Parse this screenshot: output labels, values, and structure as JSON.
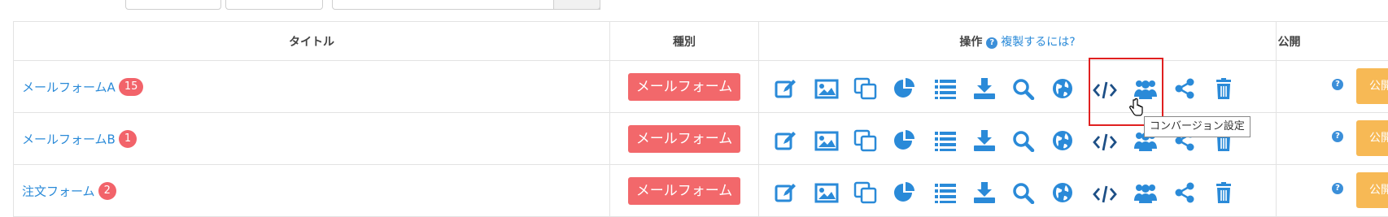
{
  "table": {
    "headers": {
      "title": "タイトル",
      "type": "種別",
      "ops": "操作",
      "ops_help_icon": "?",
      "ops_help_link": "複製するには?",
      "pub": "公開"
    },
    "rows": [
      {
        "title": "メールフォームA",
        "count": "15",
        "type": "メールフォーム",
        "pub_label": "公開"
      },
      {
        "title": "メールフォームB",
        "count": "1",
        "type": "メールフォーム",
        "pub_label": "公開"
      },
      {
        "title": "注文フォーム",
        "count": "2",
        "type": "メールフォーム",
        "pub_label": "公開"
      }
    ],
    "op_icons": [
      "edit-icon",
      "image-icon",
      "copy-icon",
      "pie-chart-icon",
      "list-icon",
      "download-icon",
      "search-icon",
      "globe-icon",
      "code-icon",
      "users-icon",
      "share-icon",
      "trash-icon"
    ]
  },
  "tooltip": {
    "text": "コンバージョン設定"
  },
  "colors": {
    "link": "#2a8ad8",
    "badge": "#f2636a",
    "type_badge": "#f2686b",
    "publish": "#f7b955",
    "highlight": "#e02020"
  }
}
